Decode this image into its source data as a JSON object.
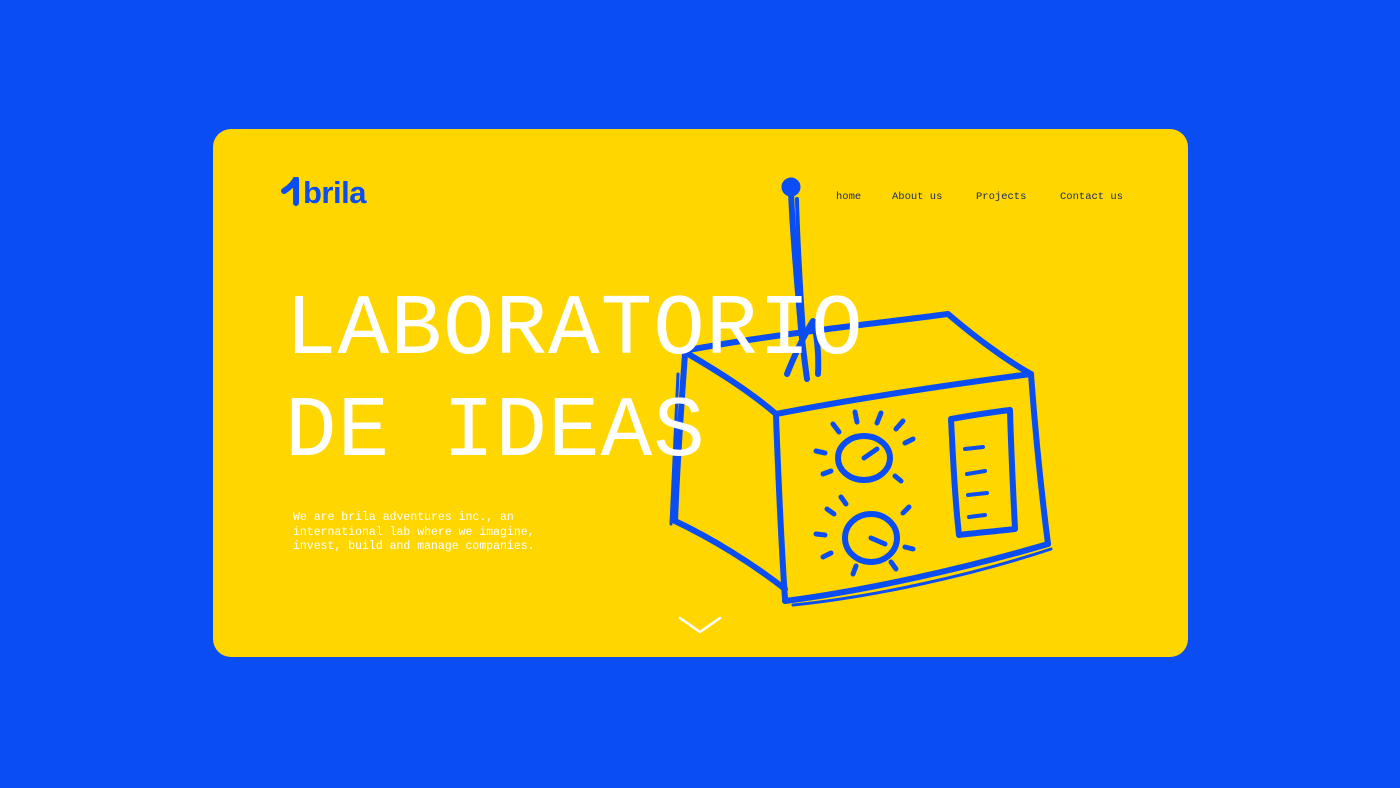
{
  "brand": {
    "logo_text": "brila",
    "logo_mark_icon": "flame-one-icon"
  },
  "nav": {
    "items": [
      {
        "label": "home"
      },
      {
        "label": "About us"
      },
      {
        "label": "Projects"
      },
      {
        "label": "Contact us"
      }
    ]
  },
  "hero": {
    "title_line1": "LABORATORIO",
    "title_line2": "DE IDEAS",
    "intro": "We are brila adventures inc., an international lab where we imagine, invest, build and manage companies.",
    "illustration_icon": "radio-sketch-icon",
    "scroll_icon": "chevron-down-icon"
  },
  "colors": {
    "background": "#0a4df2",
    "card": "#ffd600",
    "accent": "#0a4df2",
    "text_light": "#ffffff",
    "nav_text": "#1b2a66"
  }
}
